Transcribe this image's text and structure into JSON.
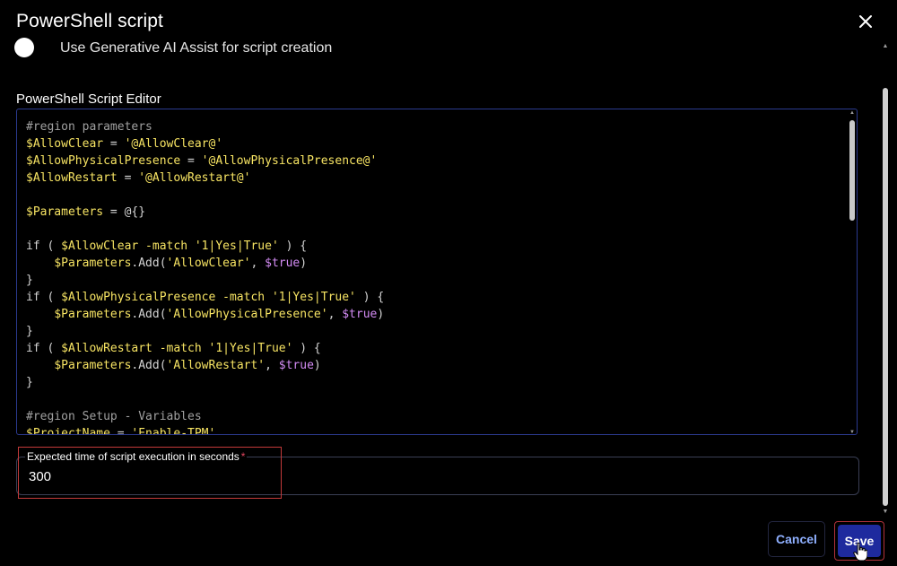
{
  "dialog": {
    "title": "PowerShell script",
    "close_icon": "close-icon"
  },
  "genai": {
    "label": "Use Generative AI Assist for script creation",
    "toggle_on": false
  },
  "editor": {
    "label": "PowerShell Script Editor",
    "lines": [
      [
        {
          "t": "#region parameters",
          "c": "comment"
        }
      ],
      [
        {
          "t": "$AllowClear",
          "c": "var"
        },
        {
          "t": " = ",
          "c": "op"
        },
        {
          "t": "'@AllowClear@'",
          "c": "str"
        }
      ],
      [
        {
          "t": "$AllowPhysicalPresence",
          "c": "var"
        },
        {
          "t": " = ",
          "c": "op"
        },
        {
          "t": "'@AllowPhysicalPresence@'",
          "c": "str"
        }
      ],
      [
        {
          "t": "$AllowRestart",
          "c": "var"
        },
        {
          "t": " = ",
          "c": "op"
        },
        {
          "t": "'@AllowRestart@'",
          "c": "str"
        }
      ],
      [],
      [
        {
          "t": "$Parameters",
          "c": "var"
        },
        {
          "t": " = @{}",
          "c": "op"
        }
      ],
      [],
      [
        {
          "t": "if",
          "c": "kw"
        },
        {
          "t": " ( ",
          "c": "op"
        },
        {
          "t": "$AllowClear",
          "c": "var"
        },
        {
          "t": " -match ",
          "c": "cond"
        },
        {
          "t": "'1|Yes|True'",
          "c": "str"
        },
        {
          "t": " ) {",
          "c": "op"
        }
      ],
      [
        {
          "t": "    ",
          "c": "op"
        },
        {
          "t": "$Parameters",
          "c": "var"
        },
        {
          "t": ".Add(",
          "c": "prop"
        },
        {
          "t": "'AllowClear'",
          "c": "str"
        },
        {
          "t": ", ",
          "c": "op"
        },
        {
          "t": "$true",
          "c": "true"
        },
        {
          "t": ")",
          "c": "op"
        }
      ],
      [
        {
          "t": "}",
          "c": "op"
        }
      ],
      [
        {
          "t": "if",
          "c": "kw"
        },
        {
          "t": " ( ",
          "c": "op"
        },
        {
          "t": "$AllowPhysicalPresence",
          "c": "var"
        },
        {
          "t": " -match ",
          "c": "cond"
        },
        {
          "t": "'1|Yes|True'",
          "c": "str"
        },
        {
          "t": " ) {",
          "c": "op"
        }
      ],
      [
        {
          "t": "    ",
          "c": "op"
        },
        {
          "t": "$Parameters",
          "c": "var"
        },
        {
          "t": ".Add(",
          "c": "prop"
        },
        {
          "t": "'AllowPhysicalPresence'",
          "c": "str"
        },
        {
          "t": ", ",
          "c": "op"
        },
        {
          "t": "$true",
          "c": "true"
        },
        {
          "t": ")",
          "c": "op"
        }
      ],
      [
        {
          "t": "}",
          "c": "op"
        }
      ],
      [
        {
          "t": "if",
          "c": "kw"
        },
        {
          "t": " ( ",
          "c": "op"
        },
        {
          "t": "$AllowRestart",
          "c": "var"
        },
        {
          "t": " -match ",
          "c": "cond"
        },
        {
          "t": "'1|Yes|True'",
          "c": "str"
        },
        {
          "t": " ) {",
          "c": "op"
        }
      ],
      [
        {
          "t": "    ",
          "c": "op"
        },
        {
          "t": "$Parameters",
          "c": "var"
        },
        {
          "t": ".Add(",
          "c": "prop"
        },
        {
          "t": "'AllowRestart'",
          "c": "str"
        },
        {
          "t": ", ",
          "c": "op"
        },
        {
          "t": "$true",
          "c": "true"
        },
        {
          "t": ")",
          "c": "op"
        }
      ],
      [
        {
          "t": "}",
          "c": "op"
        }
      ],
      [],
      [
        {
          "t": "#region Setup - Variables",
          "c": "comment"
        }
      ],
      [
        {
          "t": "$ProjectName",
          "c": "var"
        },
        {
          "t": " = ",
          "c": "op"
        },
        {
          "t": "'Enable-TPM'",
          "c": "str"
        }
      ]
    ]
  },
  "execution_time": {
    "label": "Expected time of script execution in seconds",
    "required_mark": "*",
    "value": "300"
  },
  "actions": {
    "cancel_label": "Cancel",
    "save_label": "Save"
  },
  "colors": {
    "background": "#000000",
    "accent": "#1e2a9e",
    "highlight": "#c33a3a",
    "string": "#f7e463",
    "boolean": "#d48cf5"
  }
}
